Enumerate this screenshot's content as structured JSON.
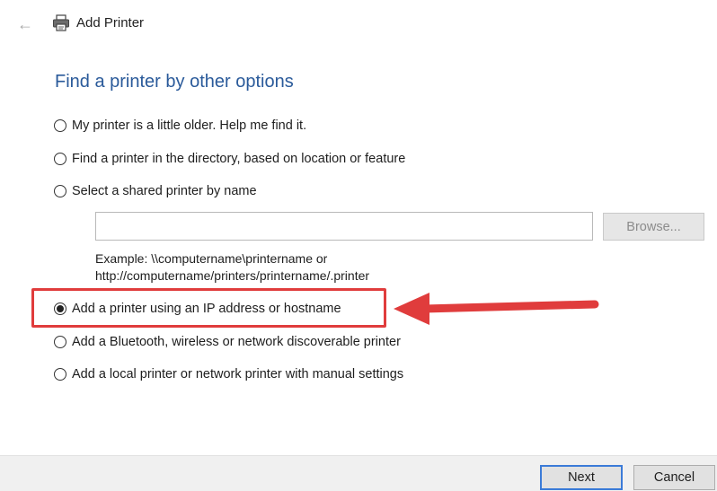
{
  "window": {
    "title": "Add Printer"
  },
  "icons": {
    "back": "back-arrow-icon",
    "printer": "printer-icon"
  },
  "heading": "Find a printer by other options",
  "options": [
    {
      "label": "My printer is a little older. Help me find it.",
      "checked": false
    },
    {
      "label": "Find a printer in the directory, based on location or feature",
      "checked": false
    },
    {
      "label": "Select a shared printer by name",
      "checked": false
    },
    {
      "label": "Add a printer using an IP address or hostname",
      "checked": true
    },
    {
      "label": "Add a Bluetooth, wireless or network discoverable printer",
      "checked": false
    },
    {
      "label": "Add a local printer or network printer with manual settings",
      "checked": false
    }
  ],
  "shared_printer": {
    "value": "",
    "browse_label": "Browse...",
    "example_line1": "Example: \\\\computername\\printername or",
    "example_line2": "http://computername/printers/printername/.printer"
  },
  "buttons": {
    "next": "Next",
    "cancel": "Cancel"
  },
  "colors": {
    "heading": "#2a5a9a",
    "annotation": "#e03c3c",
    "primary_border": "#3b7bd8"
  }
}
